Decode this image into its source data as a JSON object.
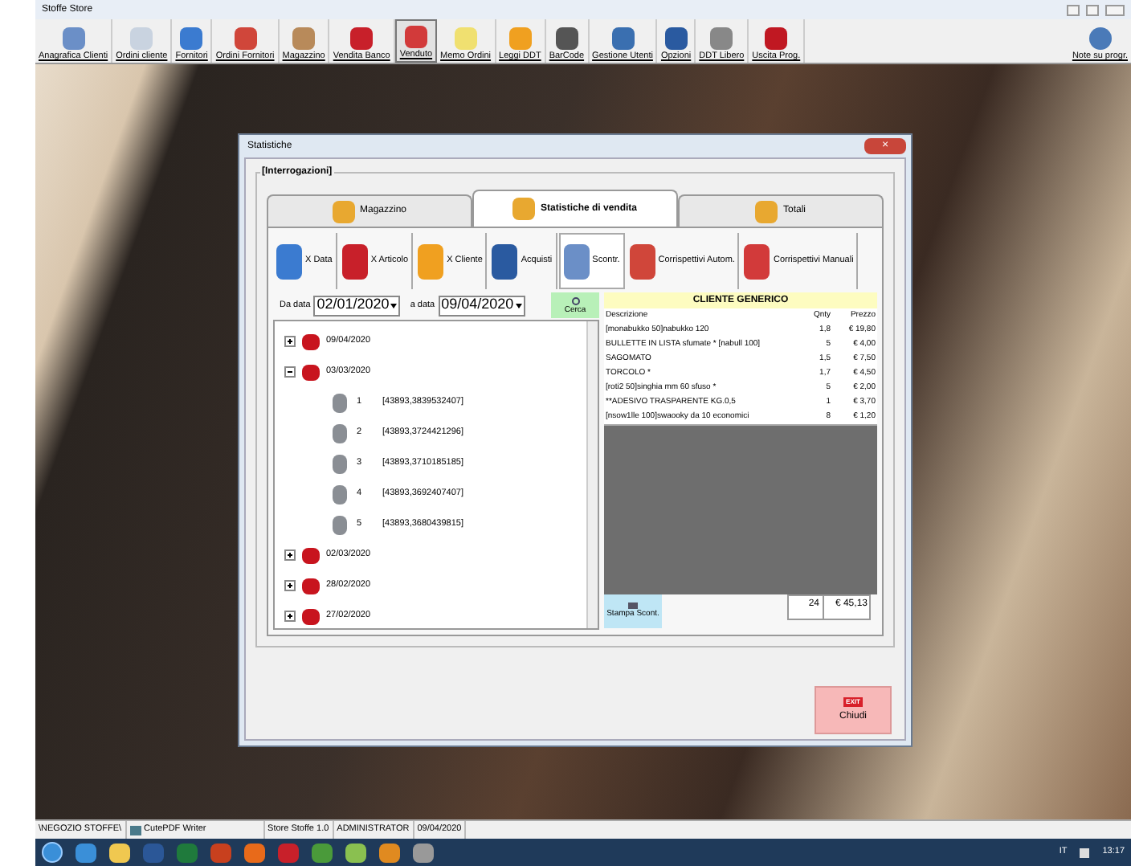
{
  "window": {
    "title": "Stoffe Store"
  },
  "toolbar": [
    {
      "label": "Anagrafica Clienti",
      "selected": false
    },
    {
      "label": "Ordini cliente",
      "selected": false
    },
    {
      "label": "Fornitori",
      "selected": false
    },
    {
      "label": "Ordini Fornitori",
      "selected": false
    },
    {
      "label": "Magazzino",
      "selected": false
    },
    {
      "label": "Vendita Banco",
      "selected": false
    },
    {
      "label": "Venduto",
      "selected": true
    },
    {
      "label": "Memo Ordini",
      "selected": false
    },
    {
      "label": "Leggi DDT",
      "selected": false
    },
    {
      "label": "BarCode",
      "selected": false
    },
    {
      "label": "Gestione Utenti",
      "selected": false
    },
    {
      "label": "Opzioni",
      "selected": false
    },
    {
      "label": "DDT Libero",
      "selected": false
    },
    {
      "label": "Uscita Prog.",
      "selected": false
    }
  ],
  "toolbar_right": {
    "label": "Note su progr."
  },
  "dialog": {
    "title": "Statistiche",
    "close": "×",
    "group": "[Interrogazioni]",
    "tabs": [
      {
        "label": "Magazzino",
        "selected": false
      },
      {
        "label": "Statistiche di vendita",
        "selected": true
      },
      {
        "label": "Totali",
        "selected": false
      }
    ],
    "subtabs": [
      {
        "label": "X Data",
        "selected": false
      },
      {
        "label": "X Articolo",
        "selected": false
      },
      {
        "label": "X Cliente",
        "selected": false
      },
      {
        "label": "Acquisti",
        "selected": false
      },
      {
        "label": "Scontr.",
        "selected": true
      },
      {
        "label": "Corrispettivi Autom.",
        "selected": false
      },
      {
        "label": "Corrispettivi Manuali",
        "selected": false
      }
    ],
    "from_label": "Da data",
    "from_value": "02/01/2020",
    "to_label": "a data",
    "to_value": "09/04/2020",
    "search_button": "Cerca",
    "tree": [
      {
        "label": "09/04/2020",
        "expanded": false
      },
      {
        "label": "03/03/2020",
        "expanded": true,
        "children": [
          {
            "label": "1",
            "value": "[43893,3839532407]"
          },
          {
            "label": "2",
            "value": "[43893,3724421296]"
          },
          {
            "label": "3",
            "value": "[43893,3710185185]"
          },
          {
            "label": "4",
            "value": "[43893,3692407407]"
          },
          {
            "label": "5",
            "value": "[43893,3680439815]"
          }
        ]
      },
      {
        "label": "02/03/2020",
        "expanded": false
      },
      {
        "label": "28/02/2020",
        "expanded": false
      },
      {
        "label": "27/02/2020",
        "expanded": false
      }
    ],
    "customer": "CLIENTE GENERICO",
    "columns": [
      "Descrizione",
      "Qnty",
      "Prezzo"
    ],
    "rows": [
      [
        "[monabukko 50]nabukko 120",
        "1,8",
        "€ 19,80"
      ],
      [
        "BULLETTE IN LISTA sfumate * [nabull 100]",
        "5",
        "€ 4,00"
      ],
      [
        "SAGOMATO",
        "1,5",
        "€ 7,50"
      ],
      [
        "TORCOLO *",
        "1,7",
        "€ 4,50"
      ],
      [
        "[roti2 50]singhia mm 60 sfuso *",
        "5",
        "€ 2,00"
      ],
      [
        "**ADESIVO TRASPARENTE KG.0,5",
        "1",
        "€ 3,70"
      ],
      [
        "[nsow1lle 100]swaooky da 10 economici",
        "8",
        "€ 1,20"
      ]
    ],
    "total_qty": "24",
    "total_price": "€ 45,13",
    "print_button": "Stampa Scont.",
    "exit_badge": "EXIT",
    "close_button": "Chiudi"
  },
  "status_bar": [
    "\\NEGOZIO STOFFE\\",
    "CutePDF Writer",
    "Store Stoffe 1.0",
    "ADMINISTRATOR",
    "09/04/2020"
  ],
  "taskbar": {
    "language": "IT",
    "time": "13:17"
  }
}
